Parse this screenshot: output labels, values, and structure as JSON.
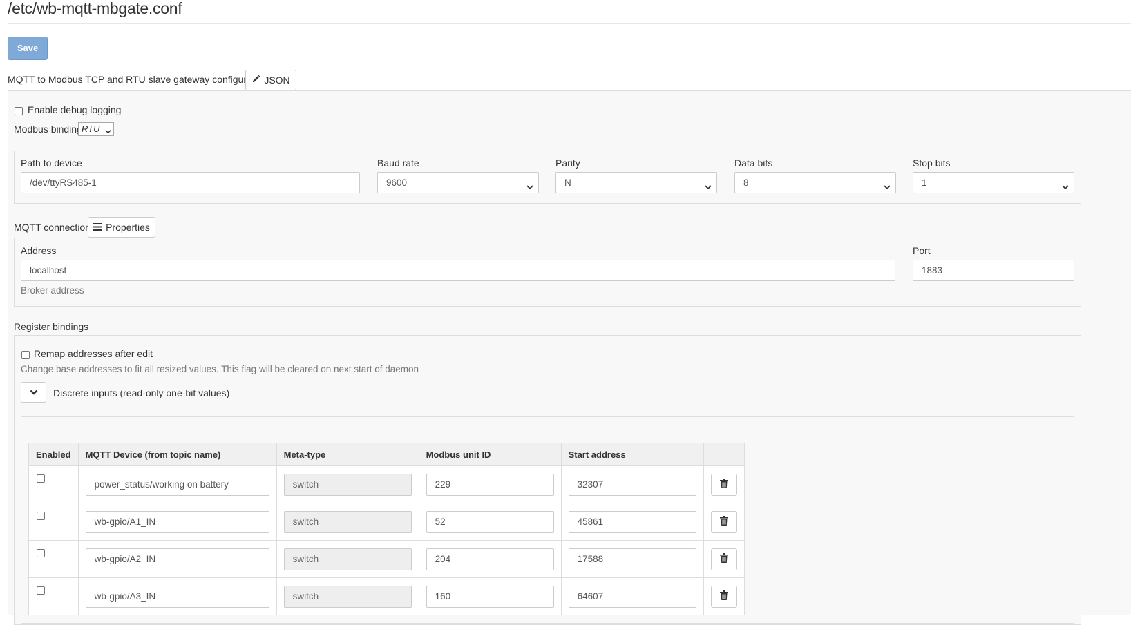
{
  "page": {
    "title": "/etc/wb-mqtt-mbgate.conf"
  },
  "toolbar": {
    "save_label": "Save"
  },
  "config": {
    "heading": "MQTT to Modbus TCP and RTU slave gateway configuration",
    "json_button": "JSON",
    "debug_label": "Enable debug logging",
    "binding_label": "Modbus binding",
    "binding_value": "RTU"
  },
  "serial": {
    "path_label": "Path to device",
    "path_value": "/dev/ttyRS485-1",
    "baud_label": "Baud rate",
    "baud_value": "9600",
    "parity_label": "Parity",
    "parity_value": "N",
    "databits_label": "Data bits",
    "databits_value": "8",
    "stopbits_label": "Stop bits",
    "stopbits_value": "1"
  },
  "mqtt": {
    "heading": "MQTT connection",
    "properties_button": "Properties",
    "address_label": "Address",
    "address_value": "localhost",
    "address_help": "Broker address",
    "port_label": "Port",
    "port_value": "1883"
  },
  "registers": {
    "heading": "Register bindings",
    "remap_label": "Remap addresses after edit",
    "remap_help": "Change base addresses to fit all resized values. This flag will be cleared on next start of daemon",
    "discrete_label": "Discrete inputs (read-only one-bit values)",
    "columns": [
      "Enabled",
      "MQTT Device (from topic name)",
      "Meta-type",
      "Modbus unit ID",
      "Start address",
      ""
    ],
    "rows": [
      {
        "enabled": false,
        "device": "power_status/working on battery",
        "meta": "switch",
        "unit": "229",
        "start": "32307"
      },
      {
        "enabled": false,
        "device": "wb-gpio/A1_IN",
        "meta": "switch",
        "unit": "52",
        "start": "45861"
      },
      {
        "enabled": false,
        "device": "wb-gpio/A2_IN",
        "meta": "switch",
        "unit": "204",
        "start": "17588"
      },
      {
        "enabled": false,
        "device": "wb-gpio/A3_IN",
        "meta": "switch",
        "unit": "160",
        "start": "64607"
      }
    ]
  }
}
